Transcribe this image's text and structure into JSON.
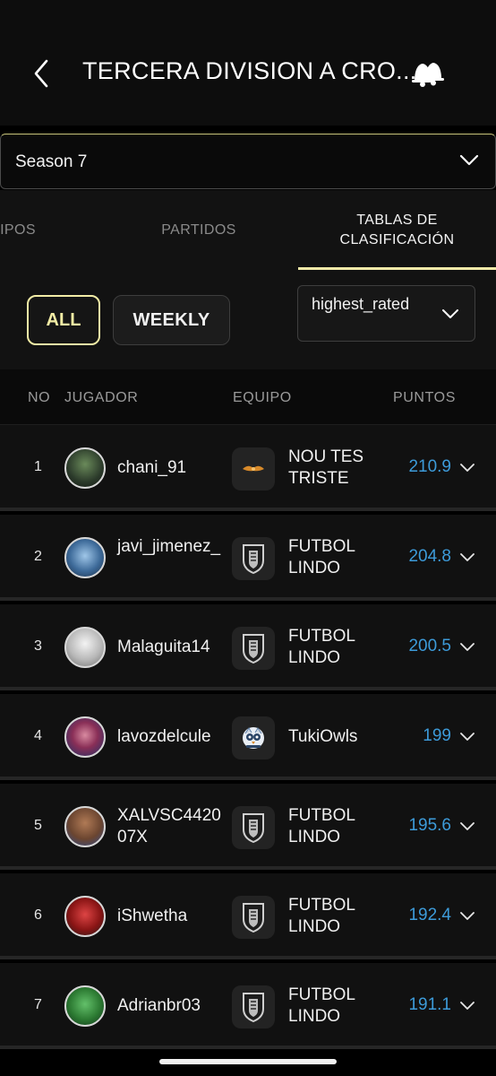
{
  "header": {
    "title": "TERCERA DIVISION A CRO...",
    "back_icon": "chevron-left-icon",
    "bell_icon": "bell-icon"
  },
  "season": {
    "value": "Season 7"
  },
  "tabs": [
    {
      "label": "IPOS",
      "active": false
    },
    {
      "label": "PARTIDOS",
      "active": false
    },
    {
      "label": "TABLAS DE CLASIFICACIÓN",
      "active": true
    }
  ],
  "filters": {
    "all_label": "ALL",
    "weekly_label": "WEEKLY",
    "sort_value": "highest_rated"
  },
  "columns": {
    "no": "NO",
    "player": "JUGADOR",
    "team": "EQUIPO",
    "points": "PUNTOS"
  },
  "colors": {
    "accent": "#f2eca6",
    "points": "#3d9bd9",
    "background": "#000000"
  },
  "rows": [
    {
      "rank": "1",
      "player": "chani_91",
      "team": "NOU TES TRISTE",
      "points": "210.9",
      "badge": "nou-tes-triste-badge"
    },
    {
      "rank": "2",
      "player": "javi_jimenez_",
      "team": "FUTBOL LINDO",
      "points": "204.8",
      "badge": "futbol-lindo-badge"
    },
    {
      "rank": "3",
      "player": "Malaguita14",
      "team": "FUTBOL LINDO",
      "points": "200.5",
      "badge": "futbol-lindo-badge"
    },
    {
      "rank": "4",
      "player": "lavozdelcule",
      "team": "TukiOwls",
      "points": "199",
      "badge": "tukiowls-badge"
    },
    {
      "rank": "5",
      "player": "XALVSC442007X",
      "team": "FUTBOL LINDO",
      "points": "195.6",
      "badge": "futbol-lindo-badge"
    },
    {
      "rank": "6",
      "player": "iShwetha",
      "team": "FUTBOL LINDO",
      "points": "192.4",
      "badge": "futbol-lindo-badge"
    },
    {
      "rank": "7",
      "player": "Adrianbr03",
      "team": "FUTBOL LINDO",
      "points": "191.1",
      "badge": "futbol-lindo-badge"
    }
  ]
}
